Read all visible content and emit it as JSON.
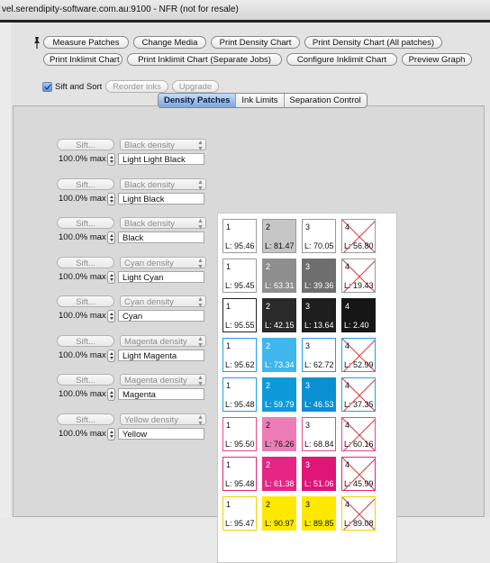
{
  "window": {
    "title": "vel.serendipity-software.com.au:9100 - NFR (not for resale)"
  },
  "toolbar": {
    "row1": [
      "Measure Patches",
      "Change Media",
      "Print Density Chart",
      "Print Density Chart (All patches)"
    ],
    "row2": [
      "Print Inklimit Chart",
      "Print Inklimit Chart (Separate Jobs)",
      "Configure Inklimit Chart",
      "Preview Graph"
    ],
    "sift_sort_label": "Sift and Sort",
    "sift_sort_checked": true,
    "reorder_inks_label": "Reorder inks",
    "upgrade_label": "Upgrade"
  },
  "tabs": [
    {
      "label": "Density Patches",
      "active": true
    },
    {
      "label": "Ink Limits",
      "active": false
    },
    {
      "label": "Separation Control",
      "active": false
    }
  ],
  "rows": [
    {
      "sift_label": "Sift...",
      "density": "Black density",
      "max": "100.0% max",
      "name": "Light Light Black",
      "patches": [
        {
          "n": "1",
          "l": "L: 95.46",
          "color": "#ffffff",
          "border": "#9a9a9a",
          "text": "#111",
          "x": false
        },
        {
          "n": "2",
          "l": "L: 81.47",
          "color": "#c6c6c6",
          "border": "#9a9a9a",
          "text": "#111",
          "x": false
        },
        {
          "n": "3",
          "l": "L: 70.05",
          "color": "#ffffff",
          "border": "#9a9a9a",
          "text": "#111",
          "x": false
        },
        {
          "n": "4",
          "l": "L: 56.80",
          "color": "#ffffff",
          "border": "#9a9a9a",
          "text": "#111",
          "x": true
        }
      ]
    },
    {
      "sift_label": "Sift...",
      "density": "Black density",
      "max": "100.0% max",
      "name": "Light Black",
      "patches": [
        {
          "n": "1",
          "l": "L: 95.45",
          "color": "#ffffff",
          "border": "#9a9a9a",
          "text": "#111",
          "x": false
        },
        {
          "n": "2",
          "l": "L: 63.31",
          "color": "#8e8e8e",
          "border": "#8e8e8e",
          "text": "#fff",
          "x": false
        },
        {
          "n": "3",
          "l": "L: 39.36",
          "color": "#6e6e6e",
          "border": "#6e6e6e",
          "text": "#fff",
          "x": false
        },
        {
          "n": "4",
          "l": "L: 19.43",
          "color": "#ffffff",
          "border": "#9a9a9a",
          "text": "#111",
          "x": true
        }
      ]
    },
    {
      "sift_label": "Sift...",
      "density": "Black density",
      "max": "100.0% max",
      "name": "Black",
      "patches": [
        {
          "n": "1",
          "l": "L: 95.55",
          "color": "#ffffff",
          "border": "#222",
          "text": "#111",
          "x": false
        },
        {
          "n": "2",
          "l": "L: 42.15",
          "color": "#2a2a2a",
          "border": "#2a2a2a",
          "text": "#fff",
          "x": false
        },
        {
          "n": "3",
          "l": "L: 13.64",
          "color": "#1e1e1e",
          "border": "#1e1e1e",
          "text": "#fff",
          "x": false
        },
        {
          "n": "4",
          "l": "L: 2.40",
          "color": "#161616",
          "border": "#161616",
          "text": "#fff",
          "x": false
        }
      ]
    },
    {
      "sift_label": "Sift...",
      "density": "Cyan density",
      "max": "100.0% max",
      "name": "Light Cyan",
      "patches": [
        {
          "n": "1",
          "l": "L: 95.62",
          "color": "#ffffff",
          "border": "#1ea1e0",
          "text": "#111",
          "x": false
        },
        {
          "n": "2",
          "l": "L: 73.34",
          "color": "#3fb6ec",
          "border": "#3fb6ec",
          "text": "#fff",
          "x": false
        },
        {
          "n": "3",
          "l": "L: 62.72",
          "color": "#ffffff",
          "border": "#1ea1e0",
          "text": "#111",
          "x": false
        },
        {
          "n": "4",
          "l": "L: 52.99",
          "color": "#ffffff",
          "border": "#1ea1e0",
          "text": "#111",
          "x": true
        }
      ]
    },
    {
      "sift_label": "Sift...",
      "density": "Cyan density",
      "max": "100.0% max",
      "name": "Cyan",
      "patches": [
        {
          "n": "1",
          "l": "L: 95.48",
          "color": "#ffffff",
          "border": "#1ea1e0",
          "text": "#111",
          "x": false
        },
        {
          "n": "2",
          "l": "L: 59.79",
          "color": "#0e9ad9",
          "border": "#0e9ad9",
          "text": "#fff",
          "x": false
        },
        {
          "n": "3",
          "l": "L: 46.53",
          "color": "#0a8fd0",
          "border": "#0a8fd0",
          "text": "#fff",
          "x": false
        },
        {
          "n": "4",
          "l": "L: 37.35",
          "color": "#ffffff",
          "border": "#1ea1e0",
          "text": "#111",
          "x": true
        }
      ]
    },
    {
      "sift_label": "Sift...",
      "density": "Magenta density",
      "max": "100.0% max",
      "name": "Light Magenta",
      "patches": [
        {
          "n": "1",
          "l": "L: 95.50",
          "color": "#ffffff",
          "border": "#e04a94",
          "text": "#111",
          "x": false
        },
        {
          "n": "2",
          "l": "L: 76.26",
          "color": "#ec7db6",
          "border": "#ec7db6",
          "text": "#111",
          "x": false
        },
        {
          "n": "3",
          "l": "L: 68.84",
          "color": "#ffffff",
          "border": "#e04a94",
          "text": "#111",
          "x": false
        },
        {
          "n": "4",
          "l": "L: 60.16",
          "color": "#ffffff",
          "border": "#e04a94",
          "text": "#111",
          "x": true
        }
      ]
    },
    {
      "sift_label": "Sift...",
      "density": "Magenta density",
      "max": "100.0% max",
      "name": "Magenta",
      "patches": [
        {
          "n": "1",
          "l": "L: 95.48",
          "color": "#ffffff",
          "border": "#e0257c",
          "text": "#111",
          "x": false
        },
        {
          "n": "2",
          "l": "L: 61.38",
          "color": "#e62584",
          "border": "#e62584",
          "text": "#fff",
          "x": false
        },
        {
          "n": "3",
          "l": "L: 51.06",
          "color": "#df1577",
          "border": "#df1577",
          "text": "#fff",
          "x": false
        },
        {
          "n": "4",
          "l": "L: 45.99",
          "color": "#ffffff",
          "border": "#e0257c",
          "text": "#111",
          "x": true
        }
      ]
    },
    {
      "sift_label": "Sift...",
      "density": "Yellow density",
      "max": "100.0% max",
      "name": "Yellow",
      "patches": [
        {
          "n": "1",
          "l": "L: 95.47",
          "color": "#ffffff",
          "border": "#f0d400",
          "text": "#111",
          "x": false
        },
        {
          "n": "2",
          "l": "L: 90.97",
          "color": "#fde900",
          "border": "#fde900",
          "text": "#111",
          "x": false
        },
        {
          "n": "3",
          "l": "L: 89.85",
          "color": "#fde900",
          "border": "#fde900",
          "text": "#111",
          "x": false
        },
        {
          "n": "4",
          "l": "L: 89.08",
          "color": "#ffffff",
          "border": "#f0d400",
          "text": "#111",
          "x": true
        }
      ]
    }
  ],
  "colors": {
    "tab_active": "#7ea6db",
    "cross": "#d93a3a"
  }
}
